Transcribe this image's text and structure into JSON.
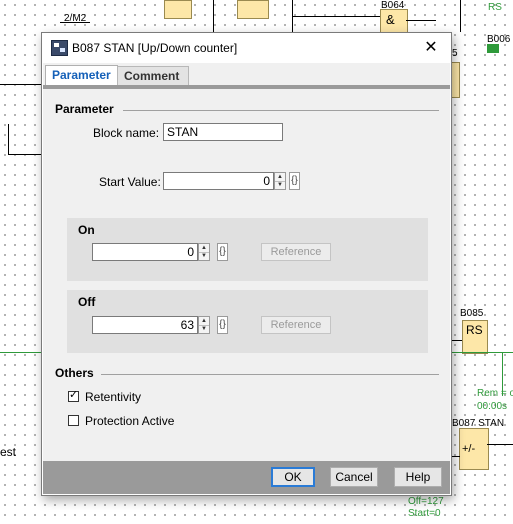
{
  "background": {
    "label_2m2": "2/M2",
    "label_b064": "B064",
    "gate_b064": "&",
    "label_b006": "B006",
    "label_rs_top": "RS",
    "label_5": "5",
    "label_b085": "B085",
    "block_b085": "RS",
    "label_b087": "B087 STAN",
    "block_b087": "+/-",
    "label_rem": "Rem = o",
    "label_time": "00:00s",
    "label_off127": "Off=127",
    "label_start0": "Start=0",
    "label_est": "est",
    "colors": {
      "block_fill": "#fde7a8",
      "wire_green": "#2e9a3a"
    }
  },
  "dialog": {
    "title": "B087 STAN [Up/Down counter]",
    "close_glyph": "✕",
    "tabs": [
      "Parameter",
      "Comment"
    ],
    "parameter": {
      "section_title": "Parameter",
      "block_name_label": "Block name:",
      "block_name_value": "STAN",
      "start_value_label": "Start Value:",
      "start_value": "0",
      "brace_glyph": "{}"
    },
    "on": {
      "title": "On",
      "value": "0",
      "reference_label": "Reference"
    },
    "off": {
      "title": "Off",
      "value": "63",
      "reference_label": "Reference"
    },
    "others": {
      "section_title": "Others",
      "retentivity_label": "Retentivity",
      "retentivity_checked": true,
      "protection_label": "Protection Active",
      "protection_checked": false
    },
    "buttons": {
      "ok": "OK",
      "cancel": "Cancel",
      "help": "Help"
    }
  }
}
